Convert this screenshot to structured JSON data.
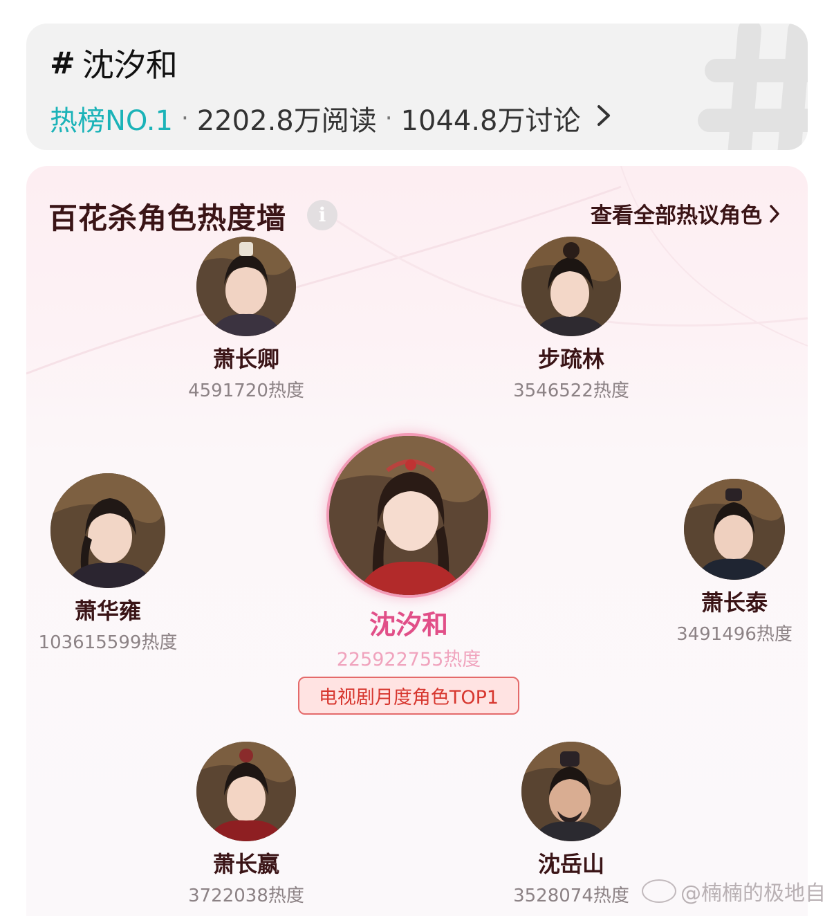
{
  "topic": {
    "hash_symbol": "#",
    "title": "沈汐和",
    "rank": "热榜NO.1",
    "separator": "·",
    "reads": "2202.8万阅读",
    "discussions": "1044.8万讨论",
    "chevron": "›"
  },
  "wall": {
    "title": "百花杀角色热度墙",
    "info_icon": "i",
    "view_all": "查看全部热议角色",
    "view_all_chevron": "›"
  },
  "characters": [
    {
      "name": "萧长卿",
      "heat": "4591720热度"
    },
    {
      "name": "步疏林",
      "heat": "3546522热度"
    },
    {
      "name": "萧华雍",
      "heat": "103615599热度"
    },
    {
      "name": "沈汐和",
      "heat": "225922755热度",
      "badge": "电视剧月度角色TOP1"
    },
    {
      "name": "萧长泰",
      "heat": "3491496热度"
    },
    {
      "name": "萧长嬴",
      "heat": "3722038热度"
    },
    {
      "name": "沈岳山",
      "heat": "3528074热度"
    }
  ],
  "watermark": "@楠楠的极地自",
  "colors": {
    "rank_teal": "#1bb3b8",
    "main_name_pink": "#e14f88",
    "badge_red": "#d7372f",
    "title_dark": "#3a1416"
  }
}
